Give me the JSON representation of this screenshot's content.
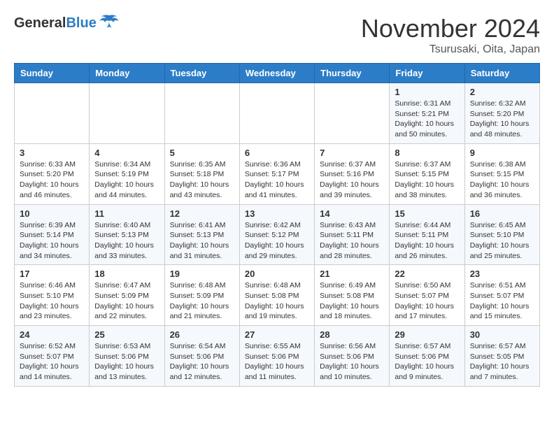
{
  "header": {
    "logo_general": "General",
    "logo_blue": "Blue",
    "month_title": "November 2024",
    "location": "Tsurusaki, Oita, Japan"
  },
  "weekdays": [
    "Sunday",
    "Monday",
    "Tuesday",
    "Wednesday",
    "Thursday",
    "Friday",
    "Saturday"
  ],
  "weeks": [
    [
      {
        "day": "",
        "info": ""
      },
      {
        "day": "",
        "info": ""
      },
      {
        "day": "",
        "info": ""
      },
      {
        "day": "",
        "info": ""
      },
      {
        "day": "",
        "info": ""
      },
      {
        "day": "1",
        "info": "Sunrise: 6:31 AM\nSunset: 5:21 PM\nDaylight: 10 hours and 50 minutes."
      },
      {
        "day": "2",
        "info": "Sunrise: 6:32 AM\nSunset: 5:20 PM\nDaylight: 10 hours and 48 minutes."
      }
    ],
    [
      {
        "day": "3",
        "info": "Sunrise: 6:33 AM\nSunset: 5:20 PM\nDaylight: 10 hours and 46 minutes."
      },
      {
        "day": "4",
        "info": "Sunrise: 6:34 AM\nSunset: 5:19 PM\nDaylight: 10 hours and 44 minutes."
      },
      {
        "day": "5",
        "info": "Sunrise: 6:35 AM\nSunset: 5:18 PM\nDaylight: 10 hours and 43 minutes."
      },
      {
        "day": "6",
        "info": "Sunrise: 6:36 AM\nSunset: 5:17 PM\nDaylight: 10 hours and 41 minutes."
      },
      {
        "day": "7",
        "info": "Sunrise: 6:37 AM\nSunset: 5:16 PM\nDaylight: 10 hours and 39 minutes."
      },
      {
        "day": "8",
        "info": "Sunrise: 6:37 AM\nSunset: 5:15 PM\nDaylight: 10 hours and 38 minutes."
      },
      {
        "day": "9",
        "info": "Sunrise: 6:38 AM\nSunset: 5:15 PM\nDaylight: 10 hours and 36 minutes."
      }
    ],
    [
      {
        "day": "10",
        "info": "Sunrise: 6:39 AM\nSunset: 5:14 PM\nDaylight: 10 hours and 34 minutes."
      },
      {
        "day": "11",
        "info": "Sunrise: 6:40 AM\nSunset: 5:13 PM\nDaylight: 10 hours and 33 minutes."
      },
      {
        "day": "12",
        "info": "Sunrise: 6:41 AM\nSunset: 5:13 PM\nDaylight: 10 hours and 31 minutes."
      },
      {
        "day": "13",
        "info": "Sunrise: 6:42 AM\nSunset: 5:12 PM\nDaylight: 10 hours and 29 minutes."
      },
      {
        "day": "14",
        "info": "Sunrise: 6:43 AM\nSunset: 5:11 PM\nDaylight: 10 hours and 28 minutes."
      },
      {
        "day": "15",
        "info": "Sunrise: 6:44 AM\nSunset: 5:11 PM\nDaylight: 10 hours and 26 minutes."
      },
      {
        "day": "16",
        "info": "Sunrise: 6:45 AM\nSunset: 5:10 PM\nDaylight: 10 hours and 25 minutes."
      }
    ],
    [
      {
        "day": "17",
        "info": "Sunrise: 6:46 AM\nSunset: 5:10 PM\nDaylight: 10 hours and 23 minutes."
      },
      {
        "day": "18",
        "info": "Sunrise: 6:47 AM\nSunset: 5:09 PM\nDaylight: 10 hours and 22 minutes."
      },
      {
        "day": "19",
        "info": "Sunrise: 6:48 AM\nSunset: 5:09 PM\nDaylight: 10 hours and 21 minutes."
      },
      {
        "day": "20",
        "info": "Sunrise: 6:48 AM\nSunset: 5:08 PM\nDaylight: 10 hours and 19 minutes."
      },
      {
        "day": "21",
        "info": "Sunrise: 6:49 AM\nSunset: 5:08 PM\nDaylight: 10 hours and 18 minutes."
      },
      {
        "day": "22",
        "info": "Sunrise: 6:50 AM\nSunset: 5:07 PM\nDaylight: 10 hours and 17 minutes."
      },
      {
        "day": "23",
        "info": "Sunrise: 6:51 AM\nSunset: 5:07 PM\nDaylight: 10 hours and 15 minutes."
      }
    ],
    [
      {
        "day": "24",
        "info": "Sunrise: 6:52 AM\nSunset: 5:07 PM\nDaylight: 10 hours and 14 minutes."
      },
      {
        "day": "25",
        "info": "Sunrise: 6:53 AM\nSunset: 5:06 PM\nDaylight: 10 hours and 13 minutes."
      },
      {
        "day": "26",
        "info": "Sunrise: 6:54 AM\nSunset: 5:06 PM\nDaylight: 10 hours and 12 minutes."
      },
      {
        "day": "27",
        "info": "Sunrise: 6:55 AM\nSunset: 5:06 PM\nDaylight: 10 hours and 11 minutes."
      },
      {
        "day": "28",
        "info": "Sunrise: 6:56 AM\nSunset: 5:06 PM\nDaylight: 10 hours and 10 minutes."
      },
      {
        "day": "29",
        "info": "Sunrise: 6:57 AM\nSunset: 5:06 PM\nDaylight: 10 hours and 9 minutes."
      },
      {
        "day": "30",
        "info": "Sunrise: 6:57 AM\nSunset: 5:05 PM\nDaylight: 10 hours and 7 minutes."
      }
    ]
  ]
}
